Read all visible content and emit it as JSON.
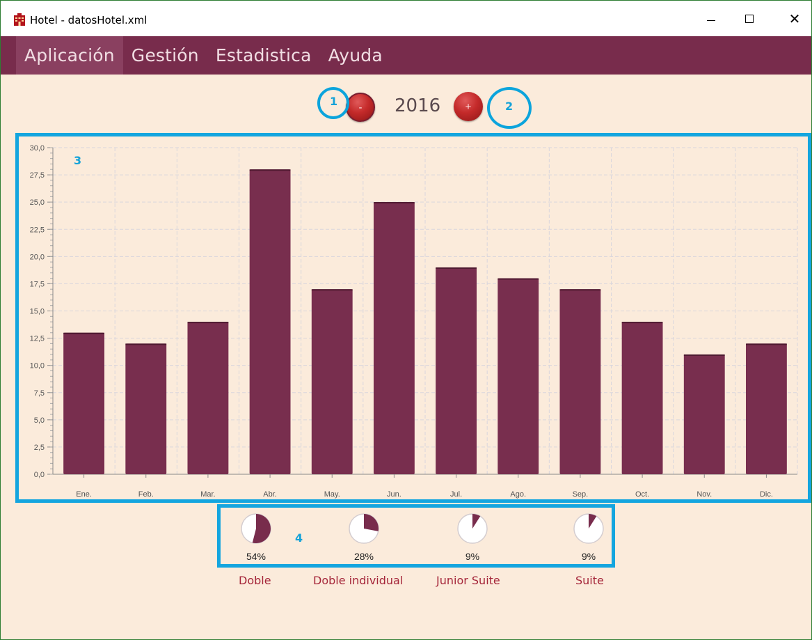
{
  "window": {
    "title": "Hotel - datosHotel.xml",
    "app_icon": "hotel-building-icon"
  },
  "window_controls": {
    "minimize_icon": "minimize-icon",
    "maximize_icon": "maximize-icon",
    "close_icon": "close-icon",
    "close_glyph": "✕"
  },
  "menu": {
    "items": [
      {
        "label": "Aplicación",
        "active": true
      },
      {
        "label": "Gestión",
        "active": false
      },
      {
        "label": "Estadistica",
        "active": false
      },
      {
        "label": "Ayuda",
        "active": false
      }
    ]
  },
  "year_selector": {
    "prev_label": "-",
    "year": "2016",
    "next_label": "+"
  },
  "callouts": {
    "one": "1",
    "two": "2",
    "three": "3",
    "four": "4"
  },
  "colors": {
    "accent": "#782c4c",
    "bar": "#782e4e",
    "background": "#fbebdb",
    "callout": "#13a5df",
    "type_label": "#a5263a"
  },
  "chart_data": {
    "type": "bar",
    "categories": [
      "Ene.",
      "Feb.",
      "Mar.",
      "Abr.",
      "May.",
      "Jun.",
      "Jul.",
      "Ago.",
      "Sep.",
      "Oct.",
      "Nov.",
      "Dic."
    ],
    "values": [
      13,
      12,
      14,
      28,
      17,
      25,
      19,
      18,
      17,
      14,
      11,
      12
    ],
    "ylim": [
      0,
      30
    ],
    "yticks": [
      "0,0",
      "2,5",
      "5,0",
      "7,5",
      "10,0",
      "12,5",
      "15,0",
      "17,5",
      "20,0",
      "22,5",
      "25,0",
      "27,5",
      "30,0"
    ],
    "grid": true,
    "legend": "none"
  },
  "room_types": [
    {
      "name": "Doble",
      "percent_label": "54%",
      "fraction": 0.54
    },
    {
      "name": "Doble individual",
      "percent_label": "28%",
      "fraction": 0.28
    },
    {
      "name": "Junior Suite",
      "percent_label": "9%",
      "fraction": 0.09
    },
    {
      "name": "Suite",
      "percent_label": "9%",
      "fraction": 0.09
    }
  ]
}
